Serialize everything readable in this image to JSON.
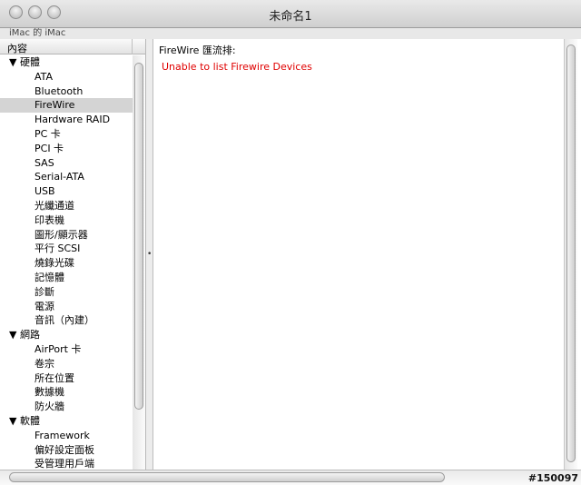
{
  "window": {
    "title": "未命名1",
    "subtitle": "iMac 的 iMac"
  },
  "sidebar": {
    "header": "內容",
    "tree": [
      {
        "type": "cat",
        "label": "▼ 硬體"
      },
      {
        "type": "item",
        "label": "ATA"
      },
      {
        "type": "item",
        "label": "Bluetooth"
      },
      {
        "type": "item",
        "label": "FireWire",
        "selected": true
      },
      {
        "type": "item",
        "label": "Hardware RAID"
      },
      {
        "type": "item",
        "label": "PC 卡"
      },
      {
        "type": "item",
        "label": "PCI 卡"
      },
      {
        "type": "item",
        "label": "SAS"
      },
      {
        "type": "item",
        "label": "Serial-ATA"
      },
      {
        "type": "item",
        "label": "USB"
      },
      {
        "type": "item",
        "label": "光纖通道"
      },
      {
        "type": "item",
        "label": "印表機"
      },
      {
        "type": "item",
        "label": "圖形/顯示器"
      },
      {
        "type": "item",
        "label": "平行 SCSI"
      },
      {
        "type": "item",
        "label": "燒錄光碟"
      },
      {
        "type": "item",
        "label": "記憶體"
      },
      {
        "type": "item",
        "label": "診斷"
      },
      {
        "type": "item",
        "label": "電源"
      },
      {
        "type": "item",
        "label": "音訊（內建）"
      },
      {
        "type": "cat",
        "label": "▼ 網路"
      },
      {
        "type": "item",
        "label": "AirPort 卡"
      },
      {
        "type": "item",
        "label": "卷宗"
      },
      {
        "type": "item",
        "label": "所在位置"
      },
      {
        "type": "item",
        "label": "數據機"
      },
      {
        "type": "item",
        "label": "防火牆"
      },
      {
        "type": "cat",
        "label": "▼ 軟體"
      },
      {
        "type": "item",
        "label": "Framework"
      },
      {
        "type": "item",
        "label": "偏好設定面板"
      },
      {
        "type": "item",
        "label": "受管理用戶端"
      }
    ]
  },
  "main": {
    "header": "FireWire 匯流排:",
    "error": "Unable to list Firewire Devices",
    "error_color": "#e00000"
  },
  "footer": {
    "watermark": "#150097"
  }
}
